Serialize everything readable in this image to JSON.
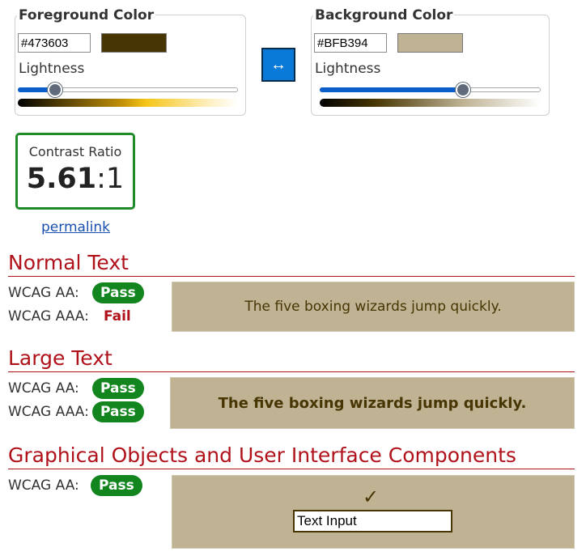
{
  "foreground": {
    "legend": "Foreground Color",
    "hex_value": "#473603",
    "swatch_color": "#473603",
    "lightness_label": "Lightness",
    "lightness_fraction": 0.17
  },
  "background": {
    "legend": "Background Color",
    "hex_value": "#BFB394",
    "swatch_color": "#BFB394",
    "lightness_label": "Lightness",
    "lightness_fraction": 0.65
  },
  "swap_button": {
    "icon": "swap-arrows-icon",
    "glyph": "↔"
  },
  "contrast": {
    "label": "Contrast Ratio",
    "value_main": "5.61",
    "value_suffix": ":1"
  },
  "permalink": "permalink",
  "normal_text": {
    "title": "Normal Text",
    "aa_label": "WCAG AA:",
    "aa_result": "Pass",
    "aaa_label": "WCAG AAA:",
    "aaa_result": "Fail",
    "sample": "The five boxing wizards jump quickly."
  },
  "large_text": {
    "title": "Large Text",
    "aa_label": "WCAG AA:",
    "aa_result": "Pass",
    "aaa_label": "WCAG AAA:",
    "aaa_result": "Pass",
    "sample": "The five boxing wizards jump quickly."
  },
  "graphical": {
    "title": "Graphical Objects and User Interface Components",
    "aa_label": "WCAG AA:",
    "aa_result": "Pass",
    "checkmark": "✓",
    "input_value": "Text Input"
  },
  "colors": {
    "pass": "#13851f",
    "fail": "#b0121b",
    "accent": "#0a7ad8",
    "ratio_border": "#1e8a2a"
  }
}
